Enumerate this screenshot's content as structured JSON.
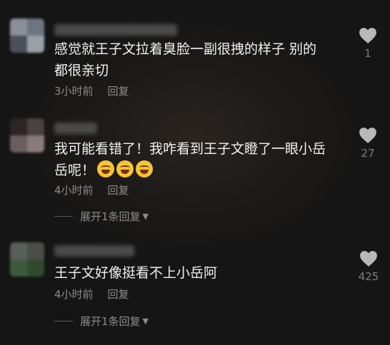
{
  "comments": [
    {
      "text_line1": "感觉就王子文拉着臭脸一副很拽的样子 别的",
      "text_line2": "都很亲切",
      "time": "3小时前",
      "reply_label": "回复",
      "likes": "1"
    },
    {
      "text_line1": "我可能看错了！我咋看到王子文瞪了一眼小岳",
      "text_line2": "岳呢！",
      "emoji_name": "laughing-tears-emoji",
      "time": "4小时前",
      "reply_label": "回复",
      "likes": "27",
      "expand_label": "展开1条回复"
    },
    {
      "text_line1": "王子文好像挺看不上小岳阿",
      "time": "4小时前",
      "reply_label": "回复",
      "likes": "425",
      "expand_label": "展开1条回复"
    }
  ],
  "icons": {
    "like": "heart-icon",
    "expand": "caret-down-icon"
  },
  "colors": {
    "background": "#171717",
    "text": "#f2f2f2",
    "meta": "#8c8c8c",
    "heart": "#b8b8b8"
  }
}
